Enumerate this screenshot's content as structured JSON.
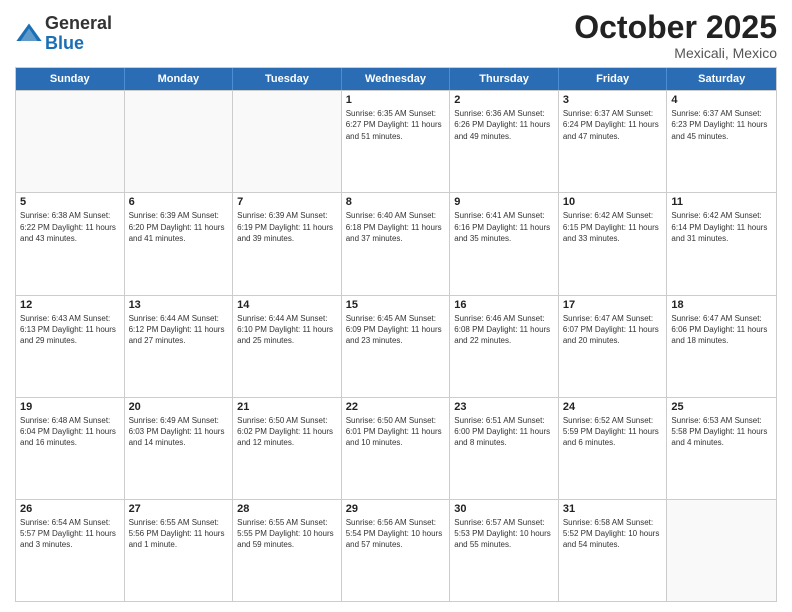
{
  "logo": {
    "general": "General",
    "blue": "Blue"
  },
  "title": "October 2025",
  "subtitle": "Mexicali, Mexico",
  "header_days": [
    "Sunday",
    "Monday",
    "Tuesday",
    "Wednesday",
    "Thursday",
    "Friday",
    "Saturday"
  ],
  "weeks": [
    [
      {
        "day": "",
        "info": ""
      },
      {
        "day": "",
        "info": ""
      },
      {
        "day": "",
        "info": ""
      },
      {
        "day": "1",
        "info": "Sunrise: 6:35 AM\nSunset: 6:27 PM\nDaylight: 11 hours\nand 51 minutes."
      },
      {
        "day": "2",
        "info": "Sunrise: 6:36 AM\nSunset: 6:26 PM\nDaylight: 11 hours\nand 49 minutes."
      },
      {
        "day": "3",
        "info": "Sunrise: 6:37 AM\nSunset: 6:24 PM\nDaylight: 11 hours\nand 47 minutes."
      },
      {
        "day": "4",
        "info": "Sunrise: 6:37 AM\nSunset: 6:23 PM\nDaylight: 11 hours\nand 45 minutes."
      }
    ],
    [
      {
        "day": "5",
        "info": "Sunrise: 6:38 AM\nSunset: 6:22 PM\nDaylight: 11 hours\nand 43 minutes."
      },
      {
        "day": "6",
        "info": "Sunrise: 6:39 AM\nSunset: 6:20 PM\nDaylight: 11 hours\nand 41 minutes."
      },
      {
        "day": "7",
        "info": "Sunrise: 6:39 AM\nSunset: 6:19 PM\nDaylight: 11 hours\nand 39 minutes."
      },
      {
        "day": "8",
        "info": "Sunrise: 6:40 AM\nSunset: 6:18 PM\nDaylight: 11 hours\nand 37 minutes."
      },
      {
        "day": "9",
        "info": "Sunrise: 6:41 AM\nSunset: 6:16 PM\nDaylight: 11 hours\nand 35 minutes."
      },
      {
        "day": "10",
        "info": "Sunrise: 6:42 AM\nSunset: 6:15 PM\nDaylight: 11 hours\nand 33 minutes."
      },
      {
        "day": "11",
        "info": "Sunrise: 6:42 AM\nSunset: 6:14 PM\nDaylight: 11 hours\nand 31 minutes."
      }
    ],
    [
      {
        "day": "12",
        "info": "Sunrise: 6:43 AM\nSunset: 6:13 PM\nDaylight: 11 hours\nand 29 minutes."
      },
      {
        "day": "13",
        "info": "Sunrise: 6:44 AM\nSunset: 6:12 PM\nDaylight: 11 hours\nand 27 minutes."
      },
      {
        "day": "14",
        "info": "Sunrise: 6:44 AM\nSunset: 6:10 PM\nDaylight: 11 hours\nand 25 minutes."
      },
      {
        "day": "15",
        "info": "Sunrise: 6:45 AM\nSunset: 6:09 PM\nDaylight: 11 hours\nand 23 minutes."
      },
      {
        "day": "16",
        "info": "Sunrise: 6:46 AM\nSunset: 6:08 PM\nDaylight: 11 hours\nand 22 minutes."
      },
      {
        "day": "17",
        "info": "Sunrise: 6:47 AM\nSunset: 6:07 PM\nDaylight: 11 hours\nand 20 minutes."
      },
      {
        "day": "18",
        "info": "Sunrise: 6:47 AM\nSunset: 6:06 PM\nDaylight: 11 hours\nand 18 minutes."
      }
    ],
    [
      {
        "day": "19",
        "info": "Sunrise: 6:48 AM\nSunset: 6:04 PM\nDaylight: 11 hours\nand 16 minutes."
      },
      {
        "day": "20",
        "info": "Sunrise: 6:49 AM\nSunset: 6:03 PM\nDaylight: 11 hours\nand 14 minutes."
      },
      {
        "day": "21",
        "info": "Sunrise: 6:50 AM\nSunset: 6:02 PM\nDaylight: 11 hours\nand 12 minutes."
      },
      {
        "day": "22",
        "info": "Sunrise: 6:50 AM\nSunset: 6:01 PM\nDaylight: 11 hours\nand 10 minutes."
      },
      {
        "day": "23",
        "info": "Sunrise: 6:51 AM\nSunset: 6:00 PM\nDaylight: 11 hours\nand 8 minutes."
      },
      {
        "day": "24",
        "info": "Sunrise: 6:52 AM\nSunset: 5:59 PM\nDaylight: 11 hours\nand 6 minutes."
      },
      {
        "day": "25",
        "info": "Sunrise: 6:53 AM\nSunset: 5:58 PM\nDaylight: 11 hours\nand 4 minutes."
      }
    ],
    [
      {
        "day": "26",
        "info": "Sunrise: 6:54 AM\nSunset: 5:57 PM\nDaylight: 11 hours\nand 3 minutes."
      },
      {
        "day": "27",
        "info": "Sunrise: 6:55 AM\nSunset: 5:56 PM\nDaylight: 11 hours\nand 1 minute."
      },
      {
        "day": "28",
        "info": "Sunrise: 6:55 AM\nSunset: 5:55 PM\nDaylight: 10 hours\nand 59 minutes."
      },
      {
        "day": "29",
        "info": "Sunrise: 6:56 AM\nSunset: 5:54 PM\nDaylight: 10 hours\nand 57 minutes."
      },
      {
        "day": "30",
        "info": "Sunrise: 6:57 AM\nSunset: 5:53 PM\nDaylight: 10 hours\nand 55 minutes."
      },
      {
        "day": "31",
        "info": "Sunrise: 6:58 AM\nSunset: 5:52 PM\nDaylight: 10 hours\nand 54 minutes."
      },
      {
        "day": "",
        "info": ""
      }
    ]
  ]
}
